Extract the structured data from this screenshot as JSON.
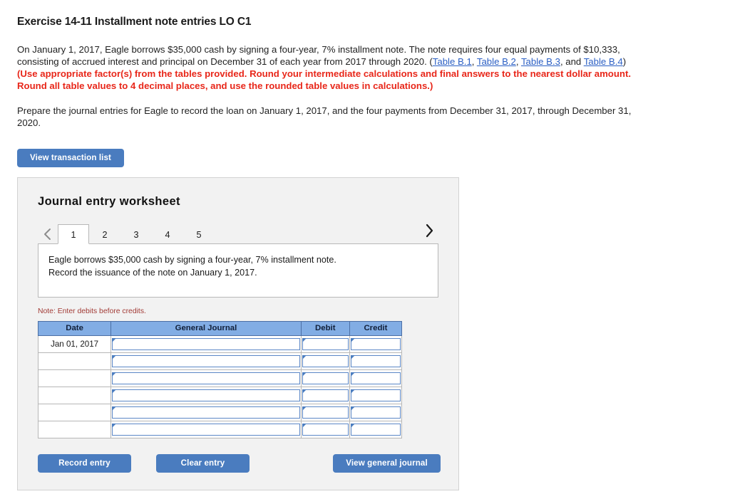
{
  "exercise": {
    "title": "Exercise 14-11 Installment note entries LO C1"
  },
  "problem": {
    "p1_part1": "On January 1, 2017, Eagle borrows $35,000 cash by signing a four-year, 7% installment note. The note requires four equal payments of $10,333, consisting of accrued interest and principal on December 31 of each year from 2017 through 2020. (",
    "link1": "Table B.1",
    "sep1": ", ",
    "link2": "Table B.2",
    "sep2": ", ",
    "link3": "Table B.3",
    "sep3": ", and ",
    "link4": "Table B.4",
    "p1_close": ") ",
    "red_instructions": "(Use appropriate factor(s) from the tables provided. Round your intermediate calculations and final answers to the nearest dollar amount. Round all table values to 4 decimal places, and use the rounded table values in calculations.)",
    "p2": "Prepare the journal entries for Eagle to record the loan on January 1, 2017, and the four payments from December 31, 2017, through December 31, 2020."
  },
  "buttons": {
    "view_transaction_list": "View transaction list",
    "record_entry": "Record entry",
    "clear_entry": "Clear entry",
    "view_general_journal": "View general journal"
  },
  "worksheet": {
    "heading": "Journal entry worksheet",
    "prev_icon": "chevron-left-icon",
    "next_icon": "chevron-right-icon",
    "tabs": [
      {
        "label": "1",
        "active": true
      },
      {
        "label": "2",
        "active": false
      },
      {
        "label": "3",
        "active": false
      },
      {
        "label": "4",
        "active": false
      },
      {
        "label": "5",
        "active": false
      }
    ],
    "description_lines": [
      "Eagle borrows $35,000 cash by signing a four-year, 7% installment note.",
      "Record the issuance of the note on January 1, 2017."
    ],
    "note": "Note: Enter debits before credits.",
    "table": {
      "headers": [
        "Date",
        "General Journal",
        "Debit",
        "Credit"
      ],
      "rows": [
        {
          "date": "Jan 01, 2017",
          "general_journal": "",
          "debit": "",
          "credit": ""
        },
        {
          "date": "",
          "general_journal": "",
          "debit": "",
          "credit": ""
        },
        {
          "date": "",
          "general_journal": "",
          "debit": "",
          "credit": ""
        },
        {
          "date": "",
          "general_journal": "",
          "debit": "",
          "credit": ""
        },
        {
          "date": "",
          "general_journal": "",
          "debit": "",
          "credit": ""
        },
        {
          "date": "",
          "general_journal": "",
          "debit": "",
          "credit": ""
        }
      ]
    }
  },
  "colors": {
    "button_blue": "#4a7cbf",
    "table_header_blue": "#82ade4",
    "red_instruction": "#e8271a",
    "note_red": "#a23b36",
    "link_blue": "#2b5fc4",
    "panel_bg": "#f2f2f2"
  }
}
